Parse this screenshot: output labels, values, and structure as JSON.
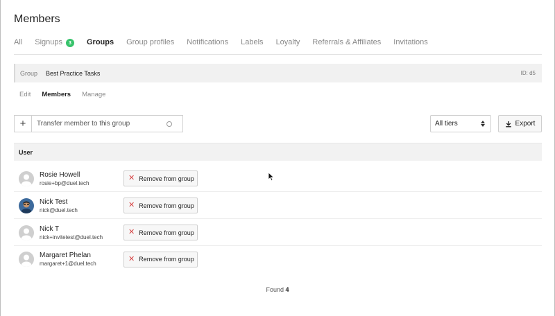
{
  "page": {
    "title": "Members"
  },
  "tabs": [
    {
      "label": "All",
      "active": false
    },
    {
      "label": "Signups",
      "active": false,
      "badge": "3"
    },
    {
      "label": "Groups",
      "active": true
    },
    {
      "label": "Group profiles",
      "active": false
    },
    {
      "label": "Notifications",
      "active": false
    },
    {
      "label": "Labels",
      "active": false
    },
    {
      "label": "Loyalty",
      "active": false
    },
    {
      "label": "Referrals & Affiliates",
      "active": false
    },
    {
      "label": "Invitations",
      "active": false
    }
  ],
  "group": {
    "label": "Group",
    "name": "Best Practice Tasks",
    "id_text": "ID: d5"
  },
  "subtabs": [
    {
      "label": "Edit",
      "active": false
    },
    {
      "label": "Members",
      "active": true
    },
    {
      "label": "Manage",
      "active": false
    }
  ],
  "transfer": {
    "plus": "+",
    "placeholder": "Transfer member to this group",
    "value": ""
  },
  "tier_select": {
    "selected": "All tiers"
  },
  "export": {
    "label": "Export",
    "icon": "download-icon"
  },
  "table": {
    "header": "User",
    "remove_label": "Remove from group",
    "rows": [
      {
        "name": "Rosie Howell",
        "email": "rosie+bp@duel.tech",
        "avatar": "default-avatar-icon"
      },
      {
        "name": "Nick Test",
        "email": "nick@duel.tech",
        "avatar": "photo-avatar"
      },
      {
        "name": "Nick T",
        "email": "nick+invitetest@duel.tech",
        "avatar": "default-avatar-icon"
      },
      {
        "name": "Margaret Phelan",
        "email": "margaret+1@duel.tech",
        "avatar": "default-avatar-icon"
      }
    ]
  },
  "footer": {
    "found_label": "Found",
    "count": "4"
  },
  "colors": {
    "badge": "#37c36b",
    "remove_x": "#d64545",
    "header_bg": "#f2f2f2"
  }
}
